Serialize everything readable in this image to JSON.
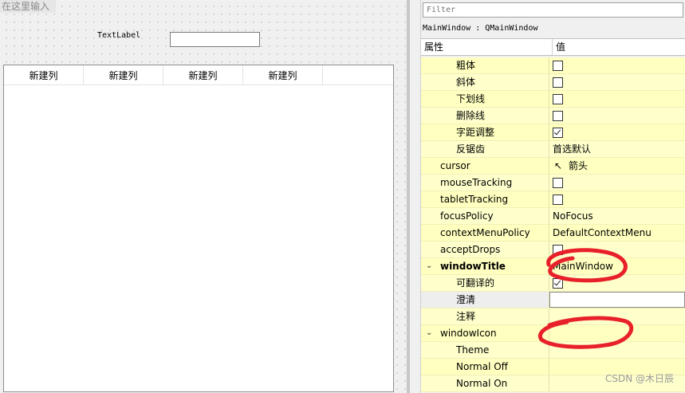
{
  "canvas": {
    "menu_placeholder": "在这里输入",
    "text_label": "TextLabel",
    "table_headers": [
      "新建列",
      "新建列",
      "新建列",
      "新建列"
    ]
  },
  "property_editor": {
    "filter_placeholder": "Filter",
    "object_label": "MainWindow : QMainWindow",
    "header_property": "属性",
    "header_value": "值",
    "rows": [
      {
        "name": "粗体",
        "level": 1,
        "type": "checkbox",
        "checked": false
      },
      {
        "name": "斜体",
        "level": 1,
        "type": "checkbox",
        "checked": false
      },
      {
        "name": "下划线",
        "level": 1,
        "type": "checkbox",
        "checked": false
      },
      {
        "name": "删除线",
        "level": 1,
        "type": "checkbox",
        "checked": false
      },
      {
        "name": "字距调整",
        "level": 1,
        "type": "checkbox",
        "checked": true
      },
      {
        "name": "反锯齿",
        "level": 1,
        "type": "text",
        "value": "首选默认"
      },
      {
        "name": "cursor",
        "level": 0,
        "type": "cursor",
        "value": "箭头"
      },
      {
        "name": "mouseTracking",
        "level": 0,
        "type": "checkbox",
        "checked": false
      },
      {
        "name": "tabletTracking",
        "level": 0,
        "type": "checkbox",
        "checked": false
      },
      {
        "name": "focusPolicy",
        "level": 0,
        "type": "text",
        "value": "NoFocus"
      },
      {
        "name": "contextMenuPolicy",
        "level": 0,
        "type": "text",
        "value": "DefaultContextMenu"
      },
      {
        "name": "acceptDrops",
        "level": 0,
        "type": "checkbox",
        "checked": false
      },
      {
        "name": "windowTitle",
        "level": 0,
        "type": "text",
        "value": "MainWindow",
        "bold": true,
        "expanded": true
      },
      {
        "name": "可翻译的",
        "level": 1,
        "type": "checkbox",
        "checked": true
      },
      {
        "name": "澄清",
        "level": 1,
        "type": "edit",
        "value": ""
      },
      {
        "name": "注释",
        "level": 1,
        "type": "text",
        "value": ""
      },
      {
        "name": "windowIcon",
        "level": 0,
        "type": "text",
        "value": "",
        "expanded": true
      },
      {
        "name": "Theme",
        "level": 1,
        "type": "text",
        "value": ""
      },
      {
        "name": "Normal Off",
        "level": 1,
        "type": "text",
        "value": ""
      },
      {
        "name": "Normal On",
        "level": 1,
        "type": "text",
        "value": ""
      }
    ]
  },
  "annotation_color": "#e8202a",
  "watermark": "CSDN @木日辰"
}
